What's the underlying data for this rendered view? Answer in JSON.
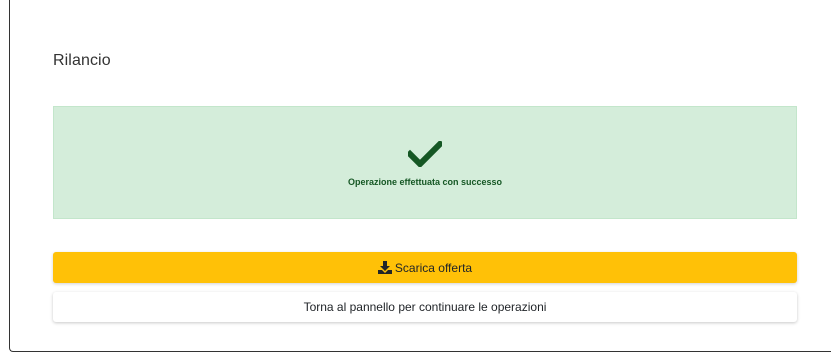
{
  "page": {
    "title": "Rilancio"
  },
  "alert": {
    "icon": "check-icon",
    "message": "Operazione effettuata con successo",
    "background": "#d4edda",
    "text_color": "#155724"
  },
  "actions": {
    "download": {
      "label": "Scarica offerta",
      "icon": "download-icon",
      "color": "#ffc107"
    },
    "back": {
      "label": "Torna al pannello per continuare le operazioni"
    }
  }
}
